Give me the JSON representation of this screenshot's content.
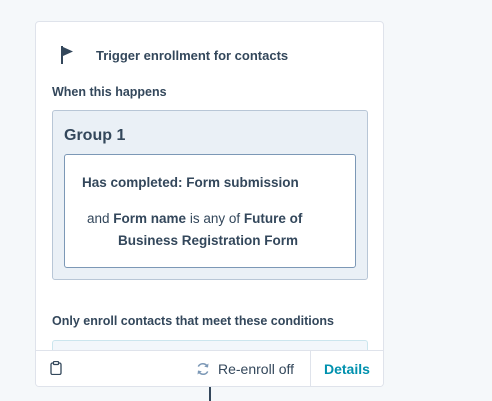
{
  "trigger": {
    "title": "Trigger enrollment for contacts",
    "when_label": "When this happens",
    "group": {
      "title": "Group 1",
      "filter_main": "Has completed: Form submission",
      "cond_prefix": "and",
      "cond_property": "Form name",
      "cond_operator": "is any of",
      "cond_value_line1": "Future of",
      "cond_value_line2": "Business Registration Form"
    },
    "only_enroll_label": "Only enroll contacts that meet these conditions"
  },
  "footer": {
    "reenroll_label": "Re-enroll off",
    "details_label": "Details"
  },
  "colors": {
    "accent_link": "#0091ae",
    "text": "#33475b",
    "group_bg": "#eaf0f6"
  },
  "icons": {
    "flag": "flag-icon",
    "clipboard": "clipboard-icon",
    "refresh": "refresh-icon"
  }
}
